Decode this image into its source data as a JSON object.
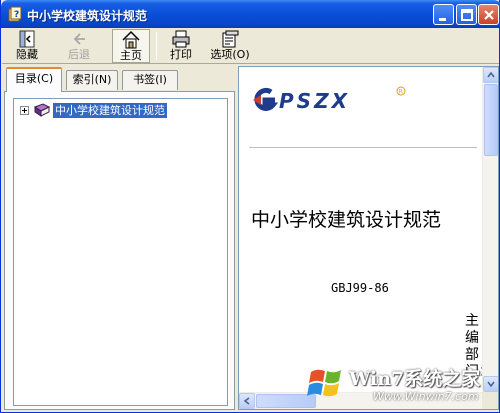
{
  "window": {
    "title": "中小学校建筑设计规范"
  },
  "toolbar": [
    {
      "key": "hide",
      "label": "隐藏",
      "icon": "hide-icon",
      "enabled": true
    },
    {
      "key": "back",
      "label": "后退",
      "icon": "back-arrow-icon",
      "enabled": false
    },
    {
      "key": "home",
      "label": "主页",
      "icon": "home-icon",
      "enabled": true,
      "active": true
    },
    {
      "key": "print",
      "label": "打印",
      "icon": "printer-icon",
      "enabled": true
    },
    {
      "key": "options",
      "label": "选项(O)",
      "icon": "options-icon",
      "enabled": true
    }
  ],
  "tabs": [
    {
      "label": "目录(C)",
      "selected": true
    },
    {
      "label": "索引(N)",
      "selected": false
    },
    {
      "label": "书签(I)",
      "selected": false
    }
  ],
  "tree": {
    "items": [
      {
        "label": "中小学校建筑设计规范",
        "icon": "book-icon",
        "selected": true,
        "collapsed": true
      }
    ]
  },
  "content": {
    "logo_text": "PSZX",
    "title": "中小学校建筑设计规范",
    "code": "GBJ99-86",
    "vertical_text": "主编部门："
  },
  "watermark": {
    "text": "Win7系统之家",
    "url": "Www.Winwin7.com"
  },
  "colors": {
    "titlebar": "#0a4fd8",
    "selection": "#316ac5",
    "logo_blue": "#1f3c8c",
    "tab_accent": "#e68b2c"
  }
}
